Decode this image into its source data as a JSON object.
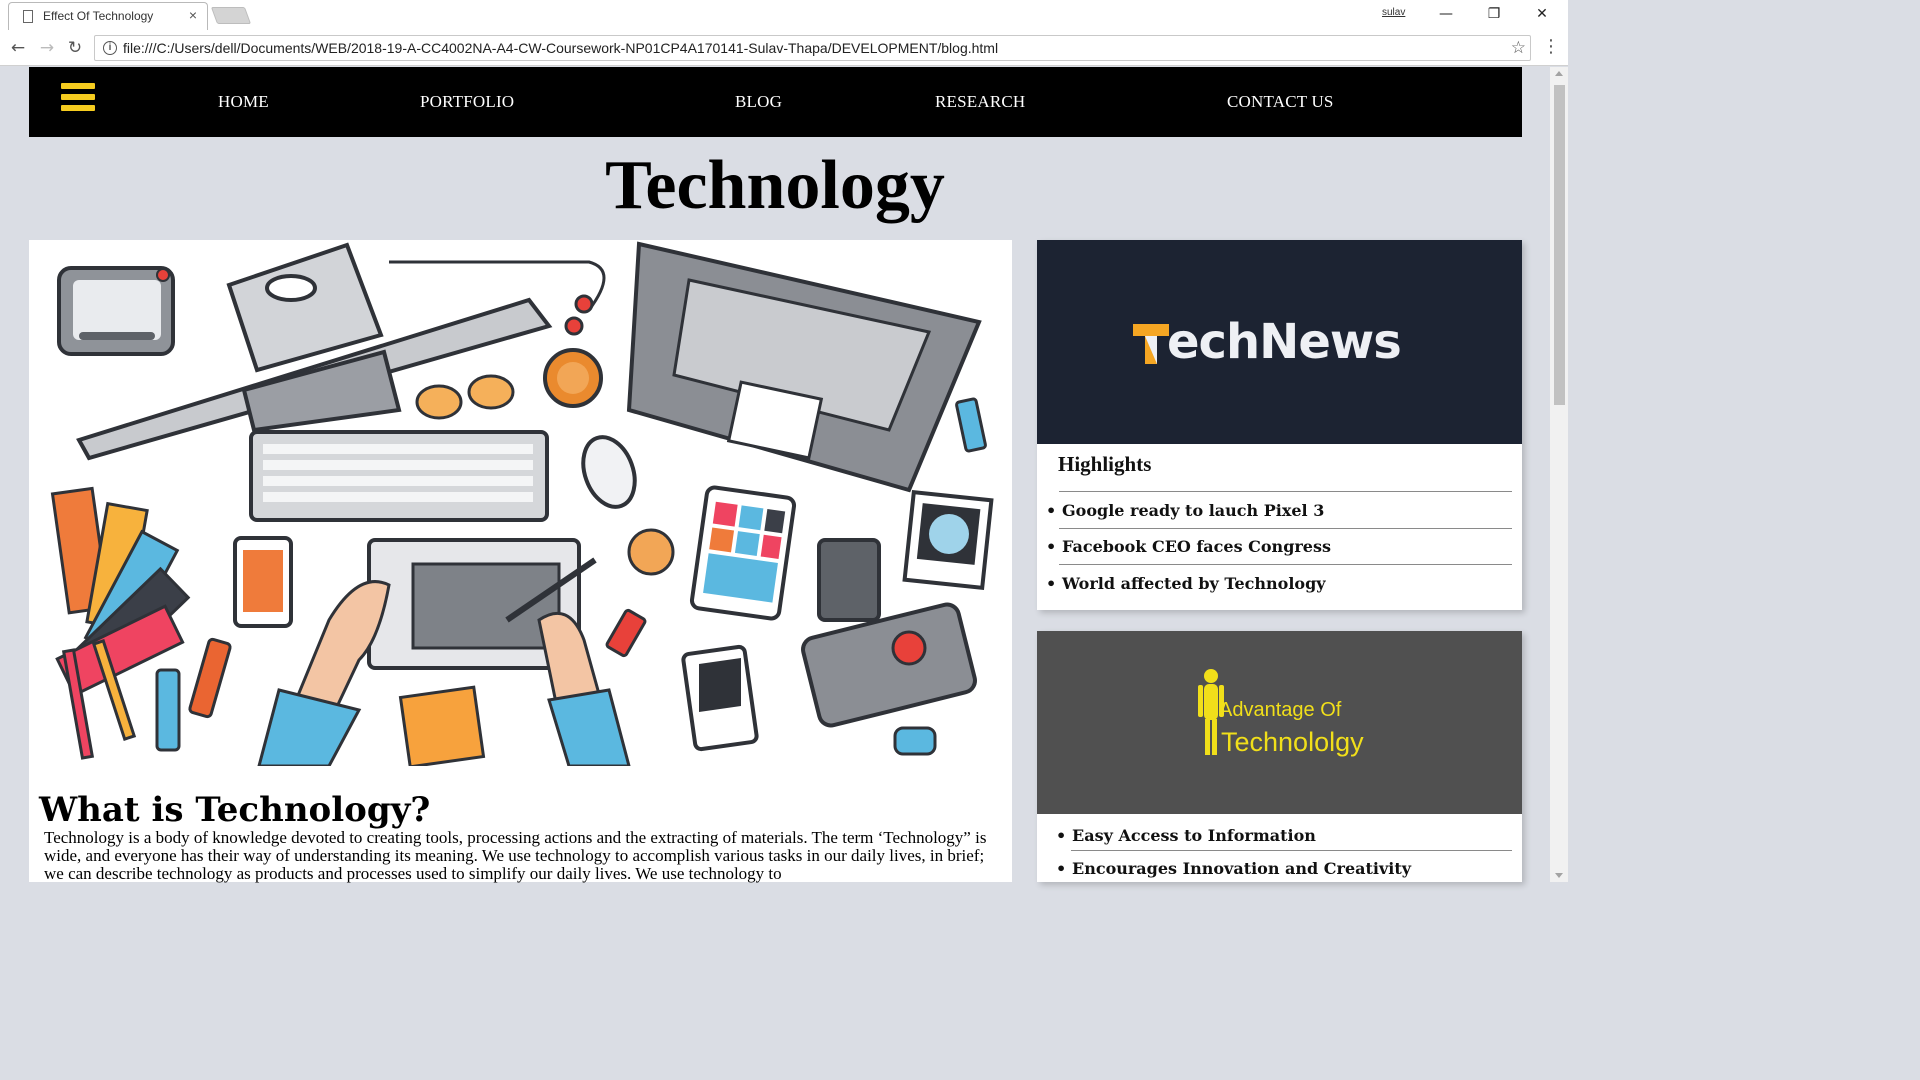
{
  "browser": {
    "tab_title": "Effect Of Technology",
    "tab_close": "×",
    "user_label": "sulav",
    "url": "file:///C:/Users/dell/Documents/WEB/2018-19-A-CC4002NA-A4-CW-Coursework-NP01CP4A170141-Sulav-Thapa/DEVELOPMENT/blog.html",
    "back_glyph": "←",
    "forward_glyph": "→",
    "reload_glyph": "↻",
    "star_glyph": "☆",
    "menu_glyph": "⋮",
    "minimize_glyph": "—",
    "restore_glyph": "❐",
    "close_glyph": "✕",
    "info_glyph": "i"
  },
  "nav": {
    "items": [
      {
        "label": "HOME"
      },
      {
        "label": "PORTFOLIO"
      },
      {
        "label": "BLOG"
      },
      {
        "label": "RESEARCH"
      },
      {
        "label": "CONTACT US"
      }
    ],
    "hamburger_color": "#f6cc1f"
  },
  "page": {
    "title": "Technology"
  },
  "article": {
    "heading": "What is Technology?",
    "body": "Technology is a body of knowledge devoted to creating tools, processing actions and the extracting of materials. The term ‘Technology” is wide, and everyone has their way of understanding its meaning. We use technology to accomplish various tasks in our daily lives, in brief; we can describe technology as products and processes used to simplify our daily lives. We use technology to"
  },
  "sidebar": {
    "technews": {
      "logo_text": "echNews",
      "banner_color": "#1c2332",
      "accent_color": "#f5a623",
      "highlights_title": "Highlights",
      "items": [
        {
          "label": "Google ready to lauch Pixel 3"
        },
        {
          "label": "Facebook CEO faces Congress"
        },
        {
          "label": "World affected by Technology"
        }
      ]
    },
    "advantage": {
      "line1": "Advantage Of",
      "line2": "Technololgy",
      "banner_color": "#505050",
      "text_color": "#f1df1a",
      "items": [
        {
          "label": "Easy Access to Information"
        },
        {
          "label": "Encourages Innovation and Creativity"
        }
      ]
    }
  }
}
